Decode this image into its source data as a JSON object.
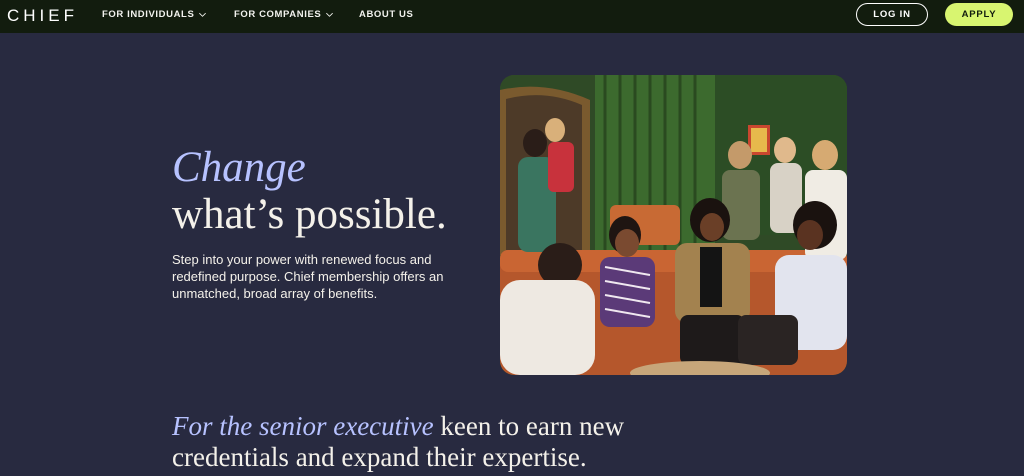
{
  "header": {
    "logo": "CHIEF",
    "nav": [
      {
        "label": "FOR INDIVIDUALS",
        "has_dropdown": true
      },
      {
        "label": "FOR COMPANIES",
        "has_dropdown": true
      },
      {
        "label": "ABOUT US",
        "has_dropdown": false
      }
    ],
    "login_label": "LOG IN",
    "apply_label": "APPLY"
  },
  "hero": {
    "headline_italic": "Change",
    "headline_regular": "what’s possible.",
    "body": "Step into your power with renewed focus and redefined purpose. Chief membership offers an unmatched, broad array of benefits."
  },
  "section": {
    "heading_accent": "For the senior executive",
    "heading_rest": " keen to earn new credentials and expand their expertise."
  },
  "colors": {
    "page_bg": "#282a40",
    "header_bg": "#121c0e",
    "accent_lavender": "#b7c2ff",
    "apply_green": "#d8f570",
    "text_light": "#f4f1ea"
  }
}
